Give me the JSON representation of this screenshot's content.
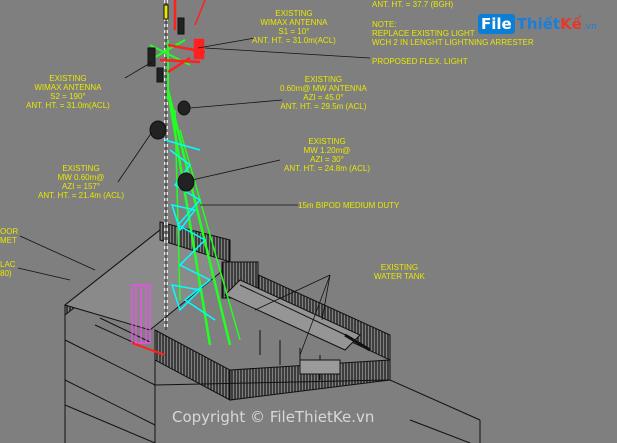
{
  "labels": {
    "top_right_1": "ANT. HT. = 37.7 (BGH)",
    "note_1": "NOTE:",
    "note_2": "REPLACE EXISTING LIGHT",
    "note_3": "WCH 2 IN LENGHT LIGHTNING ARRESTER",
    "proposed_flex": "PROPOSED FLEX. LIGHT",
    "wimax_top_1": "EXISTING",
    "wimax_top_2": "WIMAX ANTENNA",
    "wimax_top_3": "S1 = 10°",
    "wimax_top_4": "ANT. HT. = 31.0m(ACL)",
    "wimax_left_1": "EXISTING",
    "wimax_left_2": "WIMAX ANTENNA",
    "wimax_left_3": "S2 = 190°",
    "wimax_left_4": "ANT. HT. = 31.0m(ACL)",
    "mw_mid_1": "EXISTING",
    "mw_mid_2": "0.60m@ MW ANTENNA",
    "mw_mid_3": "AZI = 45.0°",
    "mw_mid_4": "ANT. HT. = 29.5m (ACL)",
    "mw_low_1": "EXISTING",
    "mw_low_2": "MW 1.20m@",
    "mw_low_3": "AZI = 30°",
    "mw_low_4": "ANT. HT. = 24.8m (ACL)",
    "mw_left_1": "EXISTING",
    "mw_left_2": "MW 0.60m@",
    "mw_left_3": "AZI = 157°",
    "mw_left_4": "ANT. HT. = 21.4m (ACL)",
    "bipod": "15m BIPOD MEDIUM DUTY",
    "water_1": "EXISTING",
    "water_2": "WATER TANK",
    "cut_1": "OOR",
    "cut_2": "MET",
    "cut_3": "LAC",
    "cut_4": "80)"
  },
  "watermark": {
    "logo_file": "File",
    "logo_thiet": "Thiết",
    "logo_ke": " Kế",
    "logo_vn": ".vn",
    "copyright": "Copyright © FileThietKe.vn"
  },
  "colors": {
    "background": "#7f7f7f",
    "annotation_text": "#e8e800",
    "tower_green": "#22ff22",
    "bracing_cyan": "#00ffff",
    "mount_red": "#ff2020",
    "pipe_magenta": "#ff44ff",
    "line_work": "#141414"
  }
}
